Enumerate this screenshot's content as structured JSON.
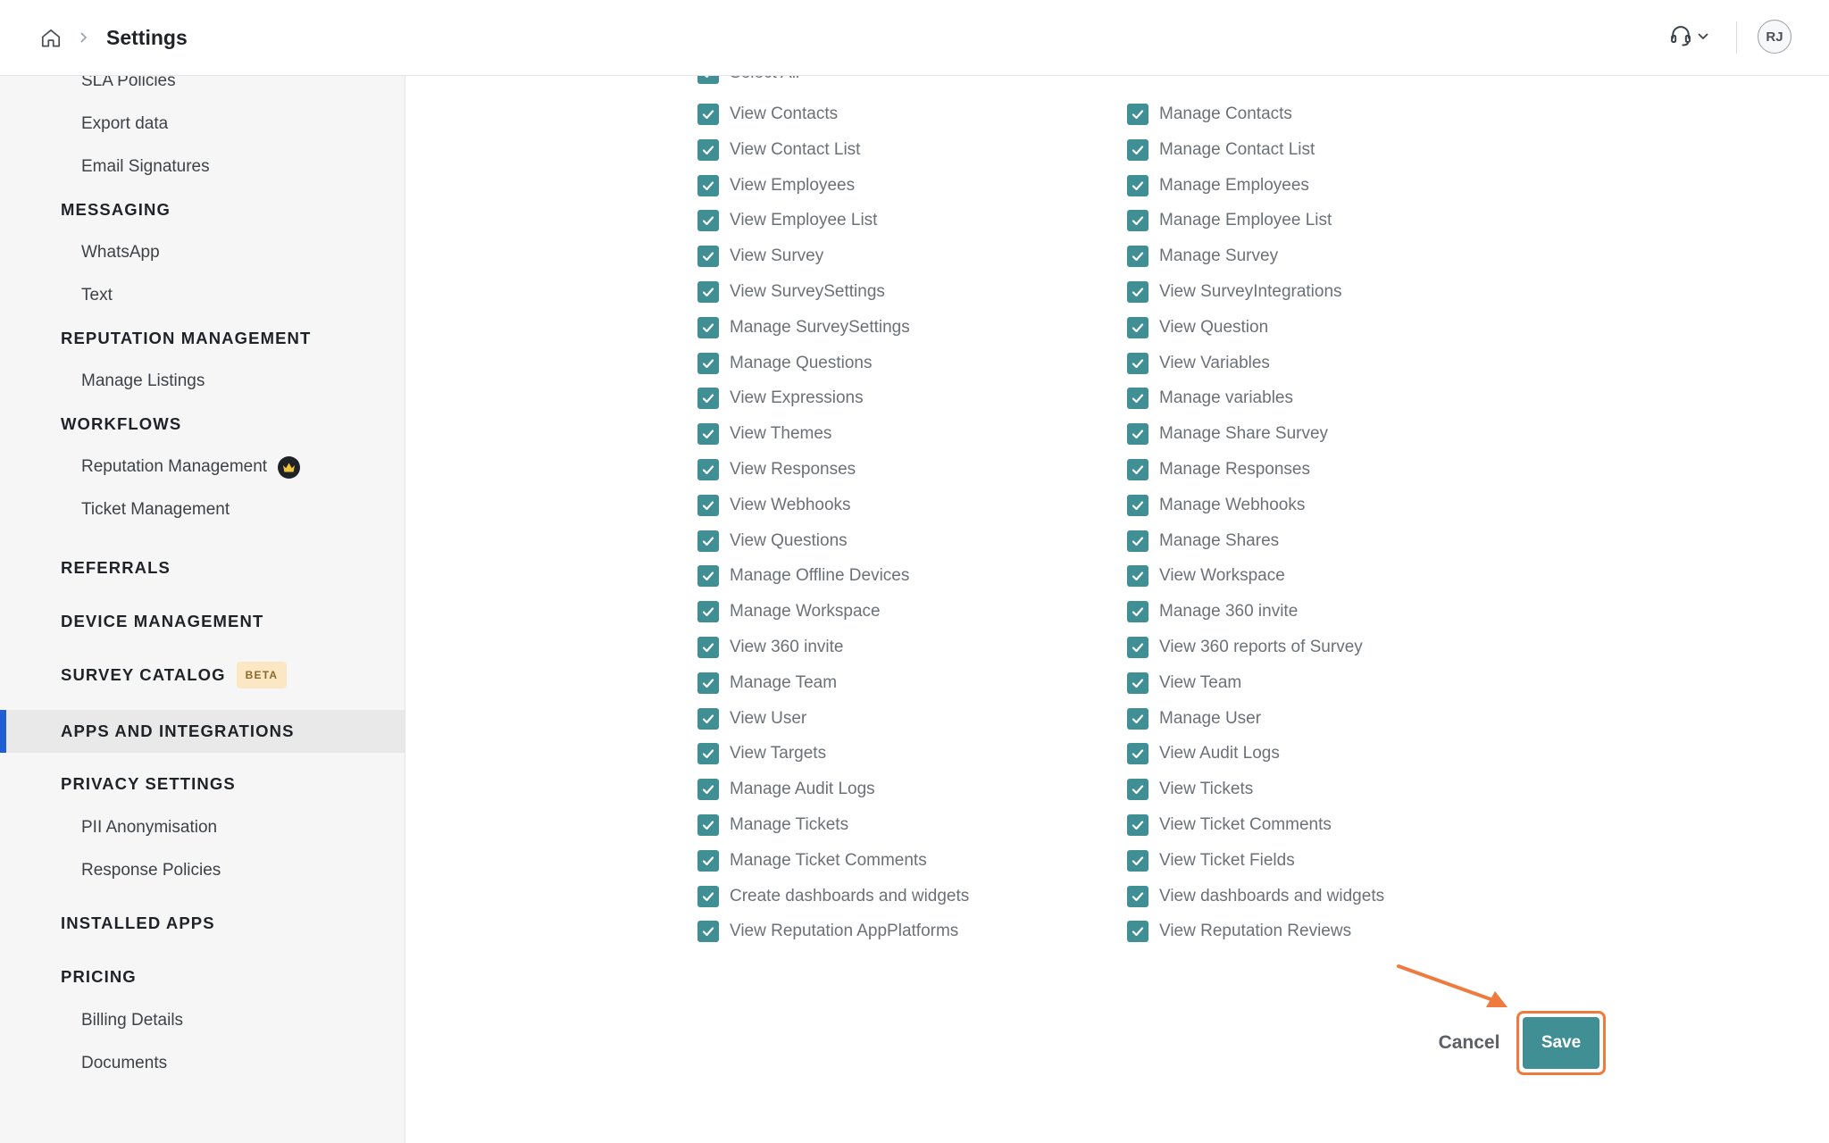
{
  "header": {
    "title": "Settings",
    "avatar_initials": "RJ"
  },
  "sidebar": [
    {
      "label": "SLA Policies",
      "kind": "sub"
    },
    {
      "label": "Export data",
      "kind": "sub"
    },
    {
      "label": "Email Signatures",
      "kind": "sub"
    },
    {
      "label": "MESSAGING",
      "kind": "head"
    },
    {
      "label": "WhatsApp",
      "kind": "sub"
    },
    {
      "label": "Text",
      "kind": "sub"
    },
    {
      "label": "REPUTATION MANAGEMENT",
      "kind": "head"
    },
    {
      "label": "Manage Listings",
      "kind": "sub"
    },
    {
      "label": "WORKFLOWS",
      "kind": "head"
    },
    {
      "label": "Reputation Management",
      "kind": "sub",
      "icon": "crown-icon"
    },
    {
      "label": "Ticket Management",
      "kind": "sub"
    },
    {
      "label": "REFERRALS",
      "kind": "head"
    },
    {
      "label": "DEVICE MANAGEMENT",
      "kind": "head"
    },
    {
      "label": "SURVEY CATALOG",
      "kind": "head",
      "badge": "BETA"
    },
    {
      "label": "APPS AND INTEGRATIONS",
      "kind": "head",
      "active": true
    },
    {
      "label": "PRIVACY SETTINGS",
      "kind": "head"
    },
    {
      "label": "PII Anonymisation",
      "kind": "sub"
    },
    {
      "label": "Response Policies",
      "kind": "sub"
    },
    {
      "label": "INSTALLED APPS",
      "kind": "head"
    },
    {
      "label": "PRICING",
      "kind": "head"
    },
    {
      "label": "Billing Details",
      "kind": "sub"
    },
    {
      "label": "Documents",
      "kind": "sub"
    }
  ],
  "permissions": {
    "select_all_label": "Select All",
    "left": [
      "View Contacts",
      "View Contact List",
      "View Employees",
      "View Employee List",
      "View Survey",
      "View SurveySettings",
      "Manage SurveySettings",
      "Manage Questions",
      "View Expressions",
      "View Themes",
      "View Responses",
      "View Webhooks",
      "View Questions",
      "Manage Offline Devices",
      "Manage Workspace",
      "View 360 invite",
      "Manage Team",
      "View User",
      "View Targets",
      "Manage Audit Logs",
      "Manage Tickets",
      "Manage Ticket Comments",
      "Create dashboards and widgets",
      "View Reputation AppPlatforms"
    ],
    "right": [
      "Manage Contacts",
      "Manage Contact List",
      "Manage Employees",
      "Manage Employee List",
      "Manage Survey",
      "View SurveyIntegrations",
      "View Question",
      "View Variables",
      "Manage variables",
      "Manage Share Survey",
      "Manage Responses",
      "Manage Webhooks",
      "Manage Shares",
      "View Workspace",
      "Manage 360 invite",
      "View 360 reports of Survey",
      "View Team",
      "Manage User",
      "View Audit Logs",
      "View Tickets",
      "View Ticket Comments",
      "View Ticket Fields",
      "View dashboards and widgets",
      "View Reputation Reviews"
    ],
    "all_checked": true
  },
  "actions": {
    "cancel_label": "Cancel",
    "save_label": "Save"
  },
  "colors": {
    "accent": "#3f8f95",
    "highlight": "#f07a3e",
    "active_bar": "#1f5fd6"
  }
}
